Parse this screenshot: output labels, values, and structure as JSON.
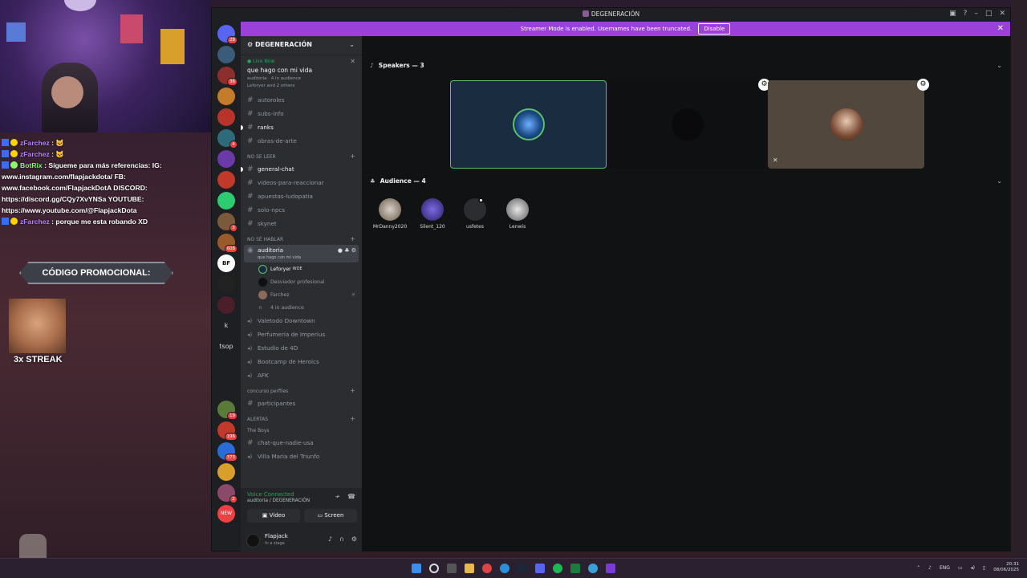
{
  "chat_overlay": {
    "lines": [
      {
        "user": "zFarchez",
        "text": " : 🐱"
      },
      {
        "user": "zFarchez",
        "text": " : 🐱"
      },
      {
        "user": "BotRix",
        "text": " : Sígueme para más referencias: IG:"
      },
      {
        "user": "",
        "text": "www.instagram.com/flapjackdota/ FB:"
      },
      {
        "user": "",
        "text": "www.facebook.com/FlapjackDotA DISCORD:"
      },
      {
        "user": "",
        "text": "https://discord.gg/CQy7XvYNSa YOUTUBE:"
      },
      {
        "user": "",
        "text": "https://www.youtube.com/@FlapjackDota"
      },
      {
        "user": "zFarchez",
        "text": " : porque me esta robando XD"
      }
    ],
    "promo": "CÓDIGO PROMOCIONAL:",
    "streak": "3x STREAK"
  },
  "window": {
    "title": "DEGENERACIÓN",
    "streamer_notice": "Streamer Mode is enabled. Usernames have been truncated.",
    "disable_label": "Disable"
  },
  "guilds": [
    {
      "badge": "28",
      "color": "#5865f2"
    },
    {
      "badge": "",
      "color": "#3b5b7a"
    },
    {
      "badge": "36",
      "color": "#8c2e2e"
    },
    {
      "badge": "",
      "color": "#c27c2a"
    },
    {
      "badge": "",
      "color": "#b8342a"
    },
    {
      "badge": "4",
      "color": "#2e6b7a"
    },
    {
      "badge": "",
      "color": "#6a3aa8"
    },
    {
      "badge": "",
      "color": "#c0392b"
    },
    {
      "badge": "",
      "color": "#2ecc71"
    },
    {
      "badge": "3",
      "color": "#7a5a3a"
    },
    {
      "badge": "608",
      "color": "#9b5a2a"
    },
    {
      "badge": "",
      "color": "#222"
    },
    {
      "badge": "",
      "color": "#4a1f2a"
    },
    {
      "badge": "",
      "color": "#1e1f22"
    },
    {
      "badge": "",
      "color": "#1e1f22"
    },
    {
      "badge": "19",
      "color": "#5a7a3a"
    },
    {
      "badge": "196",
      "color": "#c0392b"
    },
    {
      "badge": "373",
      "color": "#2a6bd8"
    },
    {
      "badge": "",
      "color": "#d8a02a"
    },
    {
      "badge": "2",
      "color": "#8b4a6a"
    }
  ],
  "guild_texts": {
    "k": "k",
    "tsop": "tsop",
    "bf": "BF",
    "new": "NEW"
  },
  "server": {
    "name": "DEGENERACIÓN",
    "live": "Live Now",
    "topic": "que hago con mi vida",
    "meta": "auditoria · 4 in audience",
    "meta2": "Leforyer and 2 others"
  },
  "channels_top": [
    "autoroles",
    "subs-info",
    "ranks",
    "obras-de-arte"
  ],
  "cat1": "NO SE LEER",
  "channels_mid": [
    "general-chat",
    "videos-para-reaccionar",
    "apuestas-ludopatia",
    "solo-npcs",
    "skynet"
  ],
  "cat2": "NO SÉ HABLAR",
  "selected": {
    "name": "auditoria",
    "sub": "que hago con mi vida"
  },
  "members": [
    {
      "name": "Leforyer",
      "tag": "WOE"
    },
    {
      "name": "Desviador profesional",
      "tag": ""
    },
    {
      "name": "Farchez",
      "tag": ""
    }
  ],
  "audience_label": "4 in audience",
  "voice_channels": [
    "Valetodo Downtown",
    "Perfumeria de Imperius",
    "Estudio de 4D",
    "Bootcamp de Heroics",
    "AFK"
  ],
  "cat3": "concurso perfiles",
  "ch_participantes": "participantes",
  "cat4": "ALERTAS",
  "cat5": "The Boys",
  "ch_chat_nadie": "chat-que-nadie-usa",
  "ch_villa": "Villa Maria del Triunfo",
  "voice_panel": {
    "status": "Voice Connected",
    "location": "auditoria / DEGENERACIÓN",
    "video_label": "Video",
    "screen_label": "Screen"
  },
  "user": {
    "name": "Flapjack",
    "status": "In a stage"
  },
  "stage": {
    "speakers_label": "Speakers — 3",
    "audience_label": "Audience — 4",
    "audience": [
      "MrDanny2020",
      "Silent_120",
      "usfetes",
      "Lenwis"
    ]
  },
  "taskbar": {
    "lang": "ENG",
    "time": "20:31",
    "date": "08/06/2025"
  },
  "colors": {
    "accent": "#9b40d8",
    "voice_green": "#23a55a",
    "speaker_border": "#5ac26a"
  }
}
